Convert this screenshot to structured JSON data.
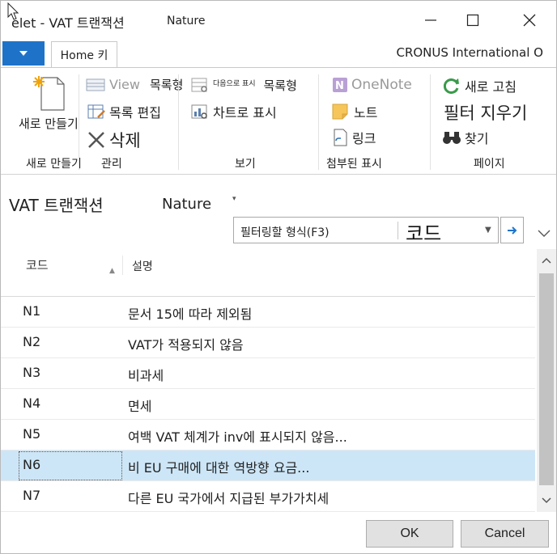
{
  "window": {
    "title": "elet - VAT 트랜잭션",
    "subtitle": "Nature"
  },
  "ribbon": {
    "tab_home": "Home 키",
    "company": "CRONUS International O",
    "new_group": {
      "new_label": "새로 만들기",
      "group_label": "새로 만들기"
    },
    "manage_group": {
      "view_list_label": "View",
      "view_list_label2": "목록형",
      "edit_list_label": "목록 편집",
      "delete_label": "삭제",
      "group_label": "관리"
    },
    "view_group": {
      "show_as_list_label": "다음으로 표시",
      "show_as_list_label2": "목록형",
      "show_as_chart_label": "차트로 표시",
      "group_label": "보기"
    },
    "attach_group": {
      "onenote_label": "OneNote",
      "notes_label": "노트",
      "links_label": "링크",
      "group_label": "첨부된 표시"
    },
    "page_group": {
      "refresh_label": "새로 고침",
      "clear_filter_label": "필터 지우기",
      "find_label": "찾기",
      "group_label": "페이지"
    }
  },
  "page": {
    "title": "VAT 트랜잭션",
    "view_name": "Nature"
  },
  "filter": {
    "placeholder": "필터링할 형식(F3)",
    "field": "코드"
  },
  "grid": {
    "columns": [
      "코드",
      "설명"
    ],
    "rows": [
      {
        "code": "N1",
        "description": "문서 15에 따라 제외됨"
      },
      {
        "code": "N2",
        "description": "VAT가 적용되지 않음"
      },
      {
        "code": "N3",
        "description": "비과세"
      },
      {
        "code": "N4",
        "description": "면세"
      },
      {
        "code": "N5",
        "description": "여백 VAT 체계가 inv에 표시되지 않음..."
      },
      {
        "code": "N6",
        "description": "비 EU 구매에 대한 역방향 요금..."
      },
      {
        "code": "N7",
        "description": "다른 EU 국가에서 지급된 부가가치세"
      }
    ],
    "selected_code": "N6"
  },
  "buttons": {
    "ok": "OK",
    "cancel": "Cancel"
  },
  "colors": {
    "accent": "#1e73c9",
    "selection": "#cde6f7",
    "button_face": "#e1e1e1"
  }
}
